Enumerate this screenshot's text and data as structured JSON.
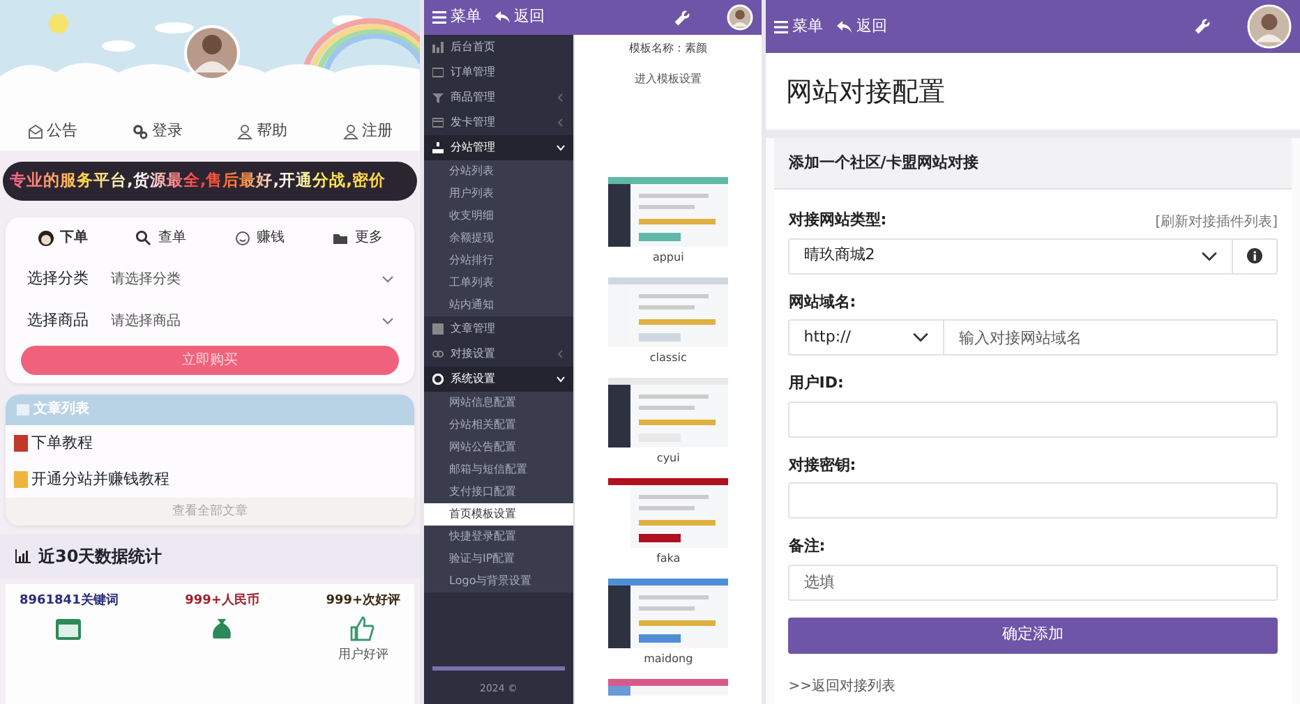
{
  "shop_screen": {
    "nav": [
      {
        "label": "公告"
      },
      {
        "label": "登录"
      },
      {
        "label": "帮助"
      },
      {
        "label": "注册"
      }
    ],
    "marquee": "专业的服务平台,货源最全,售后最好,开通分战,密价",
    "order_tabs": [
      {
        "label": "下单",
        "selected": true
      },
      {
        "label": "查单",
        "selected": false
      },
      {
        "label": "赚钱",
        "selected": false
      },
      {
        "label": "更多",
        "selected": false
      }
    ],
    "selects": [
      {
        "label": "选择分类",
        "placeholder": "请选择分类"
      },
      {
        "label": "选择商品",
        "placeholder": "请选择商品"
      }
    ],
    "buy_button": "立即购买",
    "article_list": {
      "title": "文章列表",
      "items": [
        {
          "title": "下单教程",
          "color": "#c0392b"
        },
        {
          "title": "开通分站并赚钱教程",
          "color": "#f0b43c"
        }
      ],
      "more": "查看全部文章"
    },
    "stats": {
      "title": "近30天数据统计",
      "items": [
        {
          "value": "8961841关键词",
          "color": "#2a2f7a"
        },
        {
          "value": "999+人民币",
          "color": "#a0212d"
        },
        {
          "value": "999+次好评",
          "color": "#3a2a10",
          "label": "用户好评"
        }
      ]
    }
  },
  "admin_screen": {
    "topbar": {
      "menu": "菜单",
      "back": "返回"
    },
    "sidebar": [
      {
        "kind": "link",
        "label": "后台首页"
      },
      {
        "kind": "link",
        "label": "订单管理"
      },
      {
        "kind": "group",
        "label": "商品管理",
        "expanded": false
      },
      {
        "kind": "group",
        "label": "发卡管理",
        "expanded": false
      },
      {
        "kind": "group",
        "label": "分站管理",
        "expanded": true,
        "children": [
          {
            "label": "分站列表",
            "selected": false
          },
          {
            "label": "用户列表",
            "selected": false
          },
          {
            "label": "收支明细",
            "selected": false
          },
          {
            "label": "余额提现",
            "selected": false
          },
          {
            "label": "分站排行",
            "selected": false
          },
          {
            "label": "工单列表",
            "selected": false
          },
          {
            "label": "站内通知",
            "selected": false
          }
        ]
      },
      {
        "kind": "link",
        "label": "文章管理"
      },
      {
        "kind": "group",
        "label": "对接设置",
        "expanded": false
      },
      {
        "kind": "group",
        "label": "系统设置",
        "expanded": true,
        "children": [
          {
            "label": "网站信息配置",
            "selected": false
          },
          {
            "label": "分站相关配置",
            "selected": false
          },
          {
            "label": "网站公告配置",
            "selected": false
          },
          {
            "label": "邮箱与短信配置",
            "selected": false
          },
          {
            "label": "支付接口配置",
            "selected": false
          },
          {
            "label": "首页模板设置",
            "selected": true
          },
          {
            "label": "快捷登录配置",
            "selected": false
          },
          {
            "label": "验证与IP配置",
            "selected": false
          },
          {
            "label": "Logo与背景设置",
            "selected": false
          }
        ]
      }
    ],
    "footer": "2024 ©",
    "template_name": "模板名称：素颜",
    "template_settings": "进入模板设置",
    "templates": [
      {
        "name": "appui"
      },
      {
        "name": "classic"
      },
      {
        "name": "cyui"
      },
      {
        "name": "faka"
      },
      {
        "name": "maidong"
      },
      {
        "partial": true
      }
    ]
  },
  "config_screen": {
    "topbar": {
      "menu": "菜单",
      "back": "返回"
    },
    "title": "网站对接配置",
    "card_title": "添加一个社区/卡盟网站对接",
    "type_label": "对接网站类型:",
    "refresh_link": "[刷新对接插件列表]",
    "type_value": "晴玖商城2",
    "domain_label": "网站域名:",
    "protocol": "http://",
    "domain_placeholder": "输入对接网站域名",
    "user_label": "用户ID:",
    "key_label": "对接密钥:",
    "note_label": "备注:",
    "note_placeholder": "选填",
    "submit": "确定添加",
    "back_link": ">>返回对接列表"
  }
}
